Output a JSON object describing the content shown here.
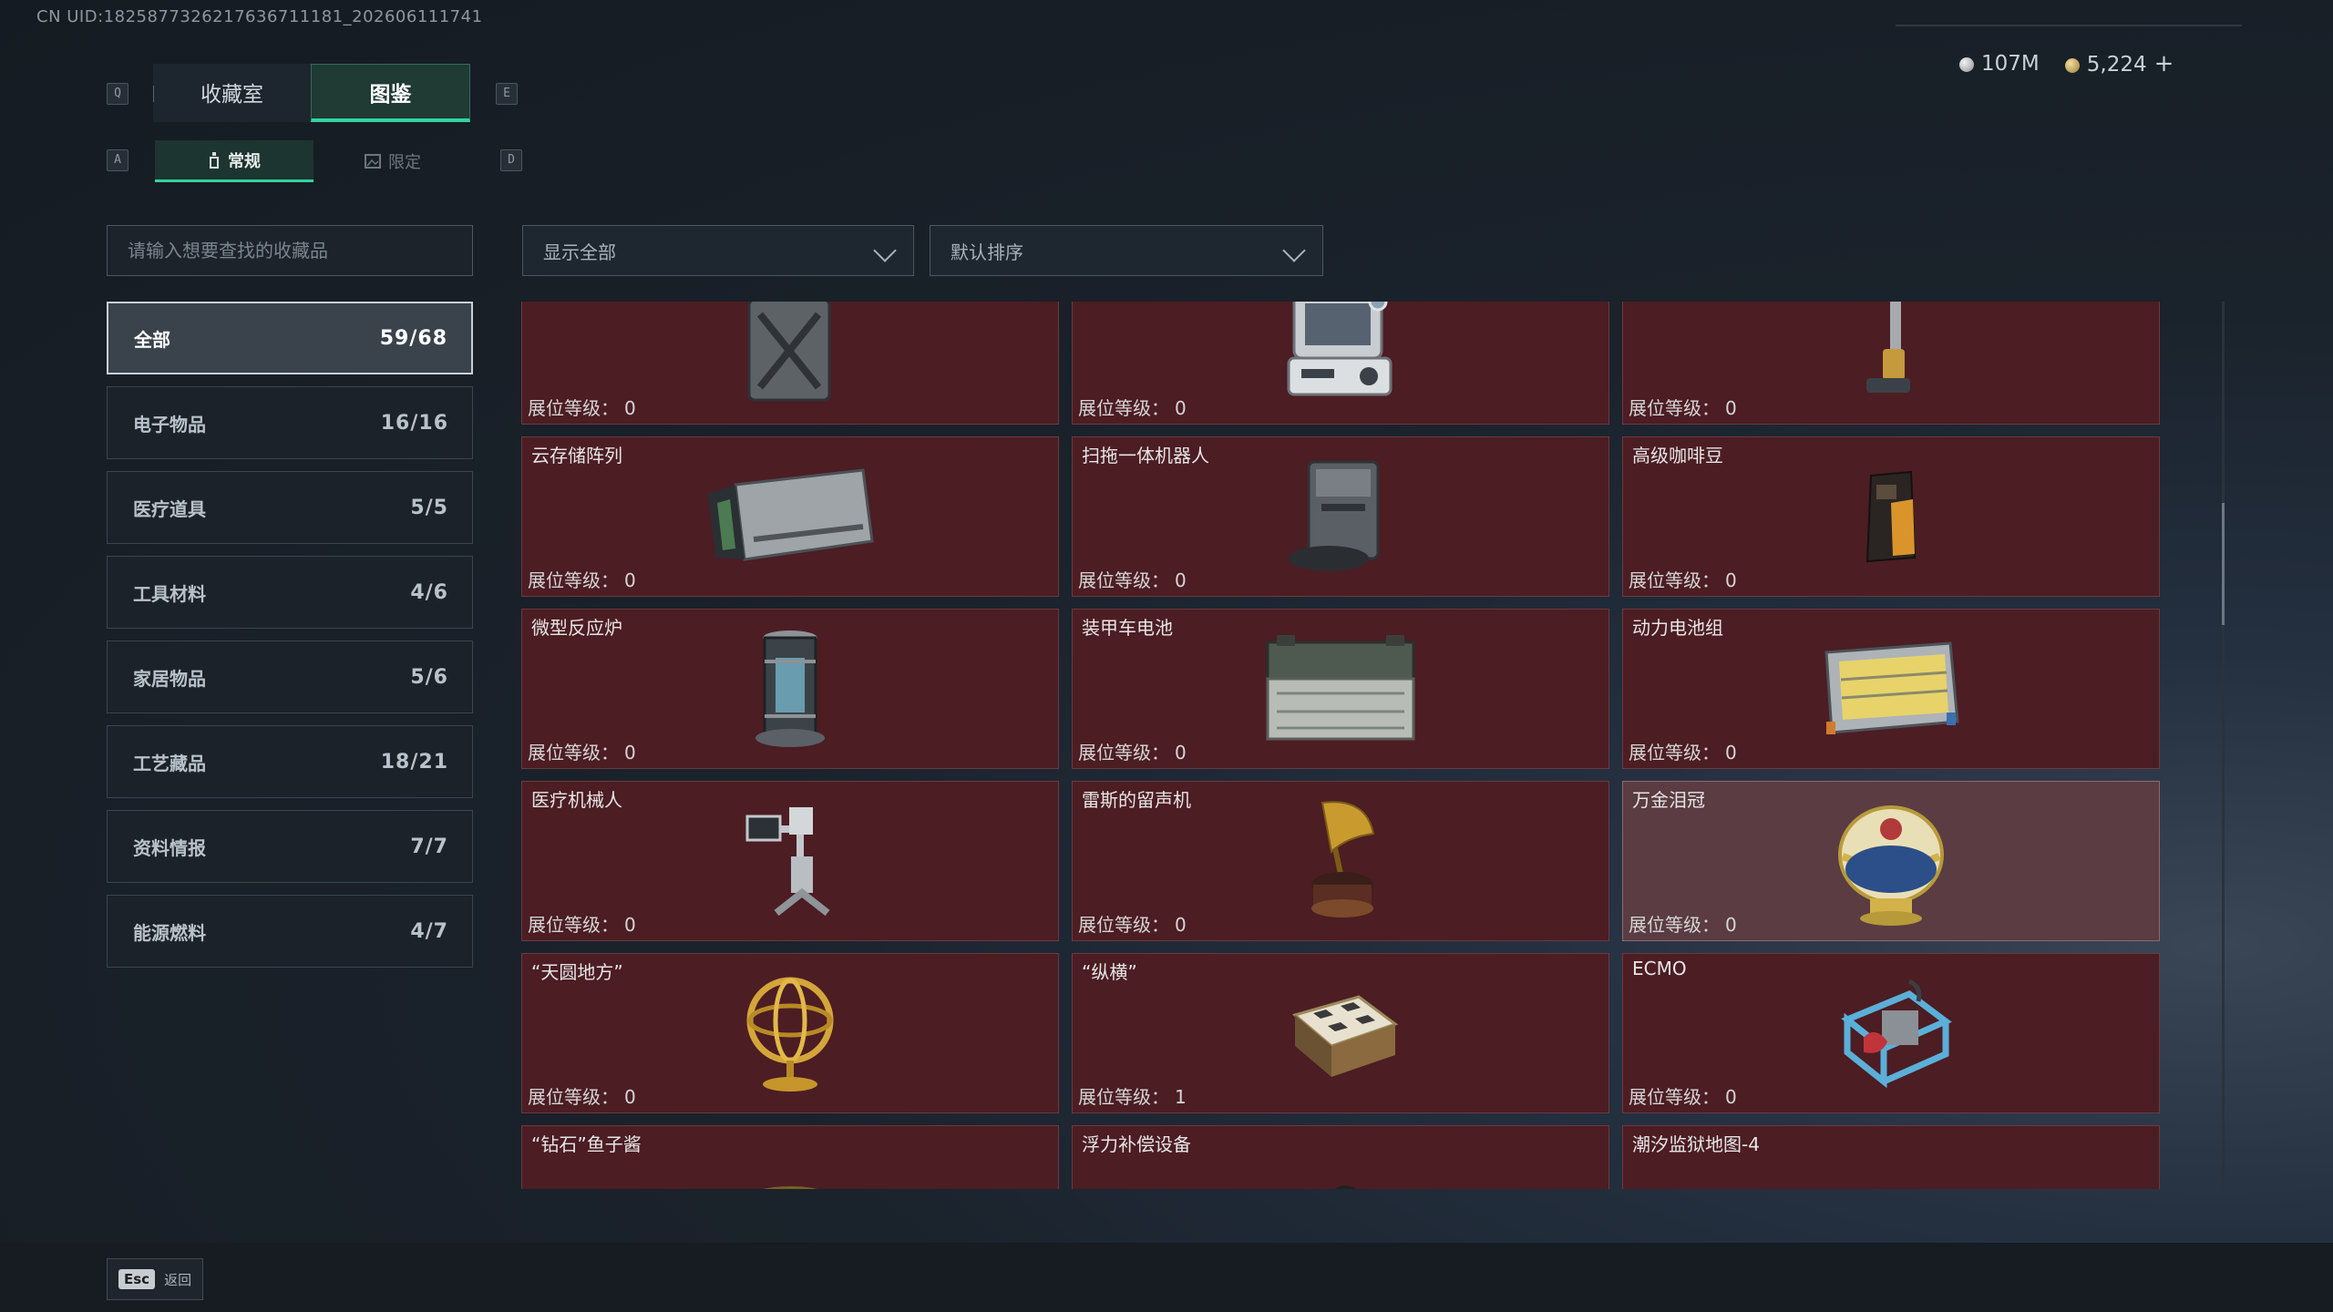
{
  "uid_text": "CN UID:1825877326217636711181_202606111741",
  "currency": {
    "silver": "107M",
    "gold": "5,224",
    "plus": "+"
  },
  "hotkeys": {
    "prev_tab": "Q",
    "next_tab": "E",
    "prev_sub": "A",
    "next_sub": "D"
  },
  "tabs": [
    {
      "label": "收藏室"
    },
    {
      "label": "图鉴"
    }
  ],
  "subtabs": [
    {
      "label": "常规"
    },
    {
      "label": "限定"
    }
  ],
  "search": {
    "placeholder": "请输入想要查找的收藏品"
  },
  "filter": {
    "value": "显示全部"
  },
  "sort": {
    "value": "默认排序"
  },
  "categories": [
    {
      "label": "全部",
      "count": "59/68"
    },
    {
      "label": "电子物品",
      "count": "16/16"
    },
    {
      "label": "医疗道具",
      "count": "5/5"
    },
    {
      "label": "工具材料",
      "count": "4/6"
    },
    {
      "label": "家居物品",
      "count": "5/6"
    },
    {
      "label": "工艺藏品",
      "count": "18/21"
    },
    {
      "label": "资料情报",
      "count": "7/7"
    },
    {
      "label": "能源燃料",
      "count": "4/7"
    }
  ],
  "level_label": "展位等级：",
  "items": [
    {
      "name": "",
      "level": "0",
      "icon": "jerrycan-icon"
    },
    {
      "name": "",
      "level": "0",
      "icon": "medical-monitor-icon"
    },
    {
      "name": "",
      "level": "0",
      "icon": "floor-washer-icon"
    },
    {
      "name": "云存储阵列",
      "level": "0",
      "icon": "storage-array-icon"
    },
    {
      "name": "扫拖一体机器人",
      "level": "0",
      "icon": "robot-vacuum-icon"
    },
    {
      "name": "高级咖啡豆",
      "level": "0",
      "icon": "coffee-bag-icon"
    },
    {
      "name": "微型反应炉",
      "level": "0",
      "icon": "reactor-icon"
    },
    {
      "name": "装甲车电池",
      "level": "0",
      "icon": "vehicle-battery-icon"
    },
    {
      "name": "动力电池组",
      "level": "0",
      "icon": "battery-pack-icon"
    },
    {
      "name": "医疗机械人",
      "level": "0",
      "icon": "medical-robot-icon"
    },
    {
      "name": "雷斯的留声机",
      "level": "0",
      "icon": "gramophone-icon"
    },
    {
      "name": "万金泪冠",
      "level": "0",
      "icon": "jeweled-egg-icon"
    },
    {
      "name": "“天圆地方”",
      "level": "0",
      "icon": "armillary-sphere-icon"
    },
    {
      "name": "“纵横”",
      "level": "1",
      "icon": "chess-box-icon"
    },
    {
      "name": "ECMO",
      "level": "0",
      "icon": "ecmo-icon"
    },
    {
      "name": "“钻石”鱼子酱",
      "level": "",
      "icon": "caviar-tin-icon"
    },
    {
      "name": "浮力补偿设备",
      "level": "",
      "icon": "buoyancy-device-icon"
    },
    {
      "name": "潮汐监狱地图-4",
      "level": "",
      "icon": "map-sheet-icon"
    }
  ],
  "footer": {
    "esc_key": "Esc",
    "esc_label": "返回"
  }
}
